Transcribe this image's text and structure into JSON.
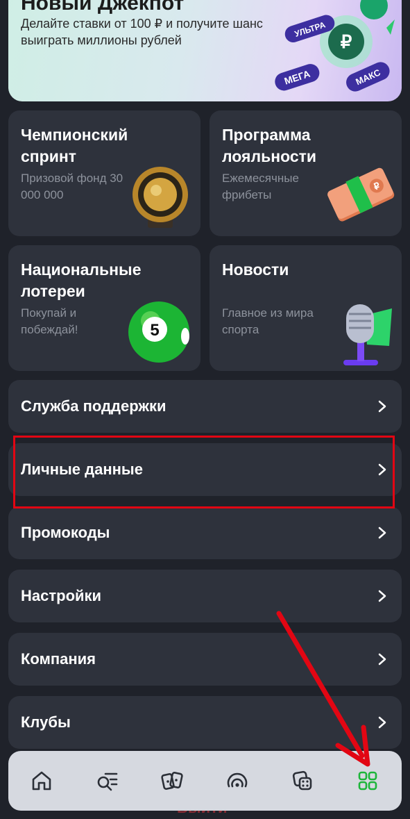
{
  "banner": {
    "title": "Новый Джекпот",
    "text": "Делайте ставки от 100 ₽ и получите шанс выиграть миллионы рублей",
    "badges": [
      "УЛЬТРА",
      "МЕГА",
      "МАКС"
    ]
  },
  "tiles": [
    {
      "title": "Чемпионский спринт",
      "subtitle": "Призовой фонд 30 000 000",
      "icon": "golden-ball-trophy-icon"
    },
    {
      "title": "Программа лояльности",
      "subtitle": "Ежемесячные фрибеты",
      "icon": "money-stack-icon"
    },
    {
      "title": "Национальные лотереи",
      "subtitle": "Покупай и побеждай!",
      "icon": "lottery-ball-icon"
    },
    {
      "title": "Новости",
      "subtitle": "Главное из мира спорта",
      "icon": "microphone-icon"
    }
  ],
  "lottery_ball_number": "5",
  "menu": [
    {
      "label": "Служба поддержки"
    },
    {
      "label": "Личные данные"
    },
    {
      "label": "Промокоды"
    },
    {
      "label": "Настройки"
    },
    {
      "label": "Компания"
    },
    {
      "label": "Клубы"
    }
  ],
  "bottom_nav": [
    {
      "icon": "home-icon"
    },
    {
      "icon": "search-list-icon"
    },
    {
      "icon": "cards-icon"
    },
    {
      "icon": "live-broadcast-icon"
    },
    {
      "icon": "dice-icon"
    },
    {
      "icon": "grid-menu-icon",
      "active": true
    }
  ],
  "hidden_text": "Выйти",
  "colors": {
    "background": "#1f222a",
    "card": "#2e323c",
    "accent_green": "#1db53a",
    "annotation_red": "#e20613"
  }
}
